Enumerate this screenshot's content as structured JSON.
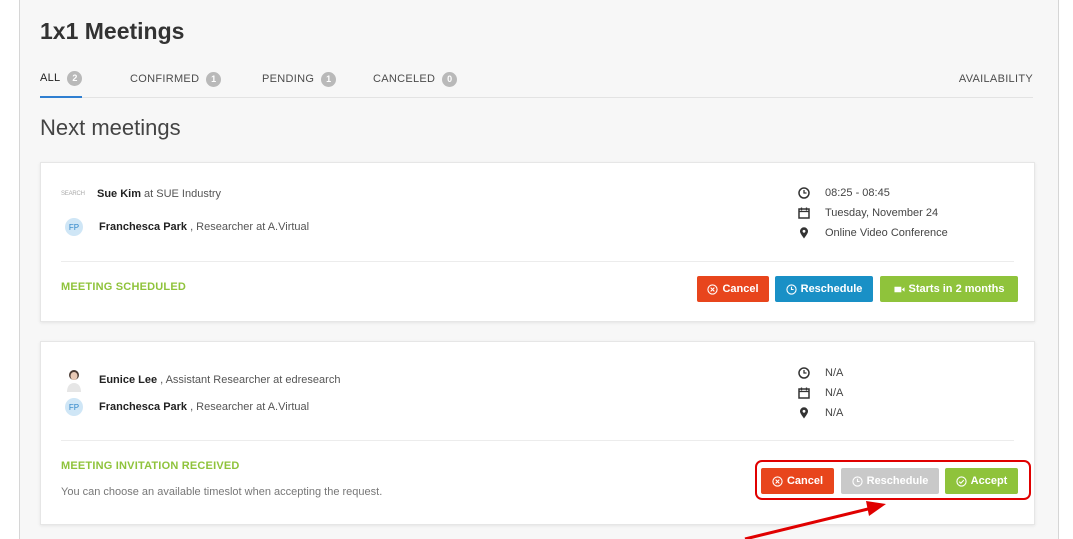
{
  "page_title": "1x1 Meetings",
  "tabs": [
    {
      "label": "ALL",
      "count": "2"
    },
    {
      "label": "CONFIRMED",
      "count": "1"
    },
    {
      "label": "PENDING",
      "count": "1"
    },
    {
      "label": "CANCELED",
      "count": "0"
    }
  ],
  "availability_label": "AVAILABILITY",
  "section_title": "Next meetings",
  "meetings": [
    {
      "org_logo_text": "SEARCH",
      "guest_name": "Sue Kim",
      "guest_role": "at SUE Industry",
      "host_initials": "FP",
      "host_name": "Franchesca Park",
      "host_role": ", Researcher at A.Virtual",
      "time": "08:25 - 08:45",
      "date": "Tuesday, November 24",
      "location": "Online Video Conference",
      "status": "MEETING SCHEDULED",
      "buttons": {
        "cancel": "Cancel",
        "reschedule": "Reschedule",
        "start": "Starts in 2 months"
      }
    },
    {
      "guest_name": "Eunice Lee",
      "guest_role": ", Assistant Researcher at edresearch",
      "host_initials": "FP",
      "host_name": "Franchesca Park",
      "host_role": ", Researcher at A.Virtual",
      "time": "N/A",
      "date": "N/A",
      "location": "N/A",
      "status": "MEETING INVITATION RECEIVED",
      "hint": "You can choose an available timeslot when accepting the request.",
      "buttons": {
        "cancel": "Cancel",
        "reschedule": "Reschedule",
        "accept": "Accept"
      }
    }
  ],
  "colors": {
    "accent_tab": "#2f7fd1",
    "status_green": "#8fc33b",
    "cancel_red": "#e8451c",
    "reschedule_blue": "#1990c6",
    "disabled_gray": "#c9c9c9",
    "annotation_red": "#e00000"
  }
}
